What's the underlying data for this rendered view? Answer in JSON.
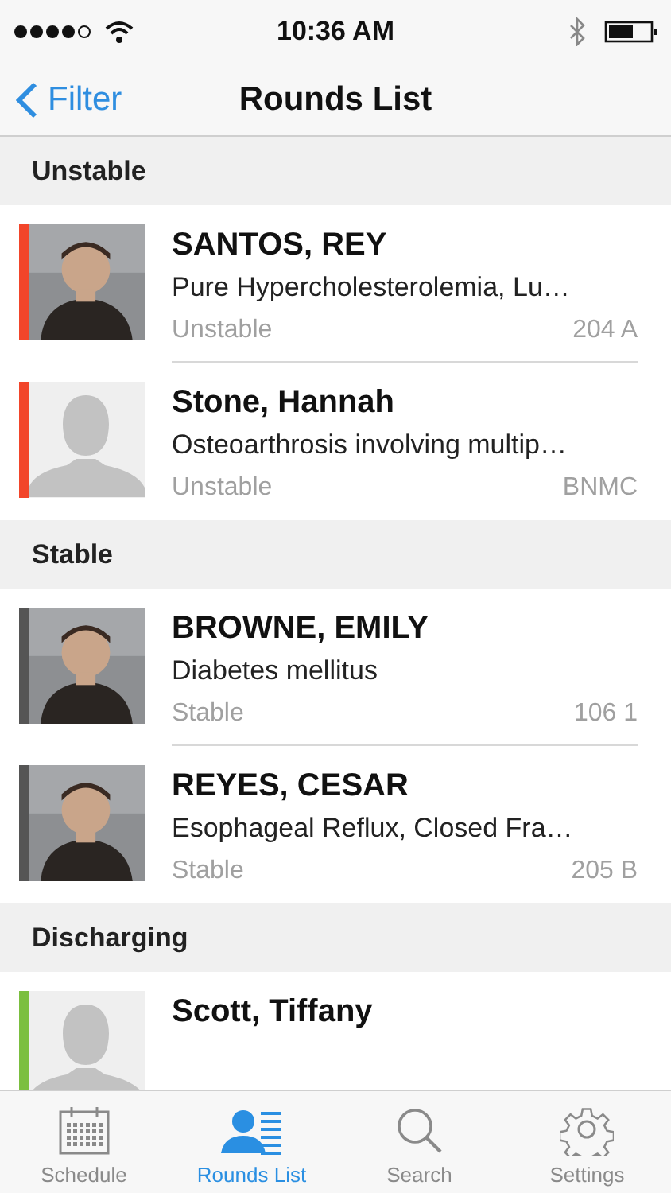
{
  "status_bar": {
    "time": "10:36 AM"
  },
  "nav": {
    "back": "Filter",
    "title": "Rounds List"
  },
  "sections": [
    {
      "title": "Unstable",
      "patients": [
        {
          "name": "SANTOS, REY",
          "diagnosis": "Pure Hypercholesterolemia, Lu…",
          "status": "Unstable",
          "location": "204 A",
          "color": "#f2452a",
          "kind": "picture"
        },
        {
          "name": "Stone, Hannah",
          "diagnosis": "Osteoarthrosis involving multip…",
          "status": "Unstable",
          "location": "BNMC",
          "color": "#f2452a",
          "kind": "placeholder"
        }
      ]
    },
    {
      "title": "Stable",
      "patients": [
        {
          "name": "BROWNE, EMILY",
          "diagnosis": "Diabetes mellitus",
          "status": "Stable",
          "location": "106 1",
          "color": "#555555",
          "kind": "picture"
        },
        {
          "name": "REYES, CESAR",
          "diagnosis": "Esophageal Reflux, Closed Fra…",
          "status": "Stable",
          "location": "205 B",
          "color": "#555555",
          "kind": "picture"
        }
      ]
    },
    {
      "title": "Discharging",
      "patients": [
        {
          "name": "Scott, Tiffany",
          "color": "#7bbf3f",
          "kind": "placeholder"
        }
      ]
    }
  ],
  "tabs": [
    {
      "label": "Schedule",
      "selected": false
    },
    {
      "label": "Rounds List",
      "selected": true
    },
    {
      "label": "Search",
      "selected": false
    },
    {
      "label": "Settings",
      "selected": false
    }
  ]
}
